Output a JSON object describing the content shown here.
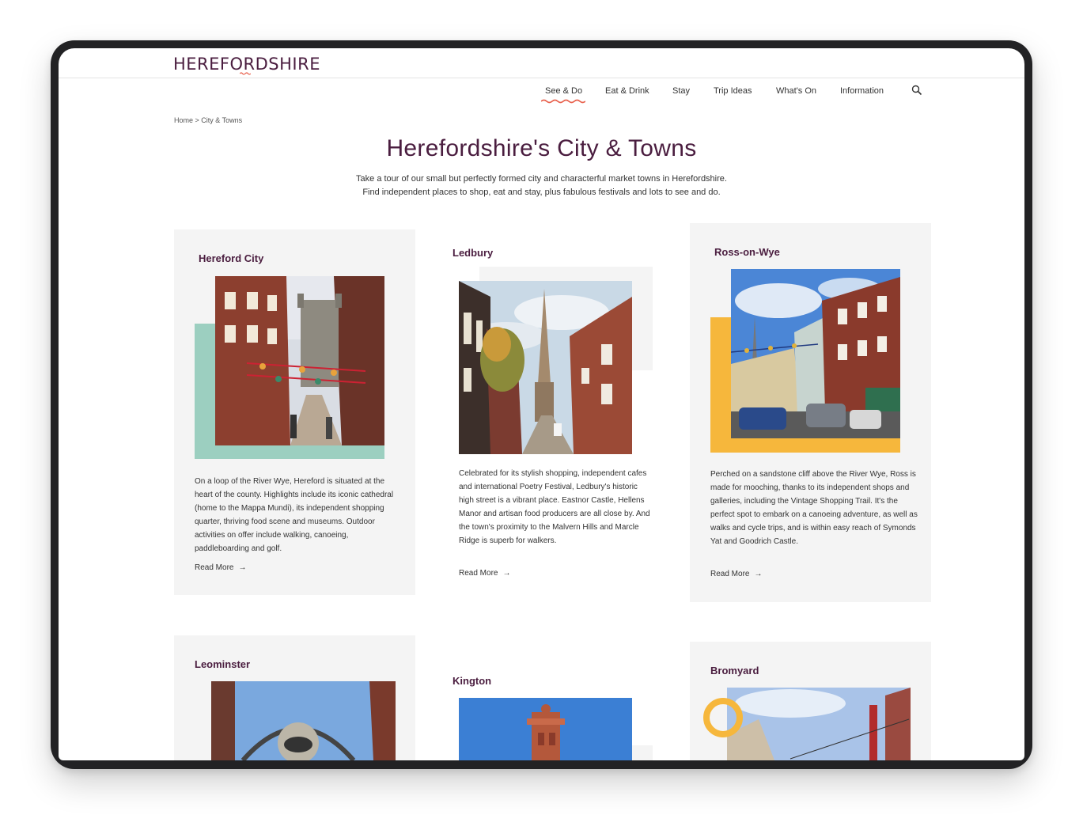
{
  "site": {
    "logo": "HEREFORDSHIRE"
  },
  "nav": {
    "items": [
      {
        "label": "See & Do",
        "active": true
      },
      {
        "label": "Eat & Drink",
        "active": false
      },
      {
        "label": "Stay",
        "active": false
      },
      {
        "label": "Trip Ideas",
        "active": false
      },
      {
        "label": "What's On",
        "active": false
      },
      {
        "label": "Information",
        "active": false
      }
    ],
    "search_icon": "search-icon"
  },
  "breadcrumb": "Home > City & Towns",
  "page": {
    "title": "Herefordshire's City & Towns",
    "intro_line1": "Take a tour of our small but perfectly formed city and characterful market towns in Herefordshire.",
    "intro_line2": "Find independent places to shop, eat and stay, plus fabulous festivals and lots to see and do."
  },
  "cards": [
    {
      "title": "Hereford City",
      "desc": "On a loop of the River Wye, Hereford is situated at the heart of the county. Highlights include its iconic cathedral (home to the Mappa Mundi), its independent shopping quarter, thriving food scene and museums. Outdoor activities on offer include walking, canoeing, paddleboarding and golf.",
      "read_more": "Read More",
      "accent_color": "#9ccfc0"
    },
    {
      "title": "Ledbury",
      "desc": "Celebrated for its stylish shopping, independent cafes and international Poetry Festival, Ledbury's historic high street is a vibrant place. Eastnor Castle, Hellens Manor and artisan food producers are all close by. And the town's proximity to the Malvern Hills and Marcle Ridge is superb for walkers.",
      "read_more": "Read More",
      "accent_color": "#f4f4f4"
    },
    {
      "title": "Ross-on-Wye",
      "desc": "Perched on a sandstone cliff above the River Wye, Ross is made for mooching, thanks to its independent shops and galleries, including the Vintage Shopping Trail. It's the perfect spot to embark on a canoeing adventure, as well as walks and cycle trips, and is within easy reach of Symonds Yat and Goodrich Castle.",
      "read_more": "Read More",
      "accent_color": "#f6b73c"
    },
    {
      "title": "Leominster"
    },
    {
      "title": "Kington"
    },
    {
      "title": "Bromyard"
    }
  ],
  "colors": {
    "brand": "#4a1d3f",
    "underline": "#e8604c",
    "card_bg": "#f4f4f4"
  }
}
